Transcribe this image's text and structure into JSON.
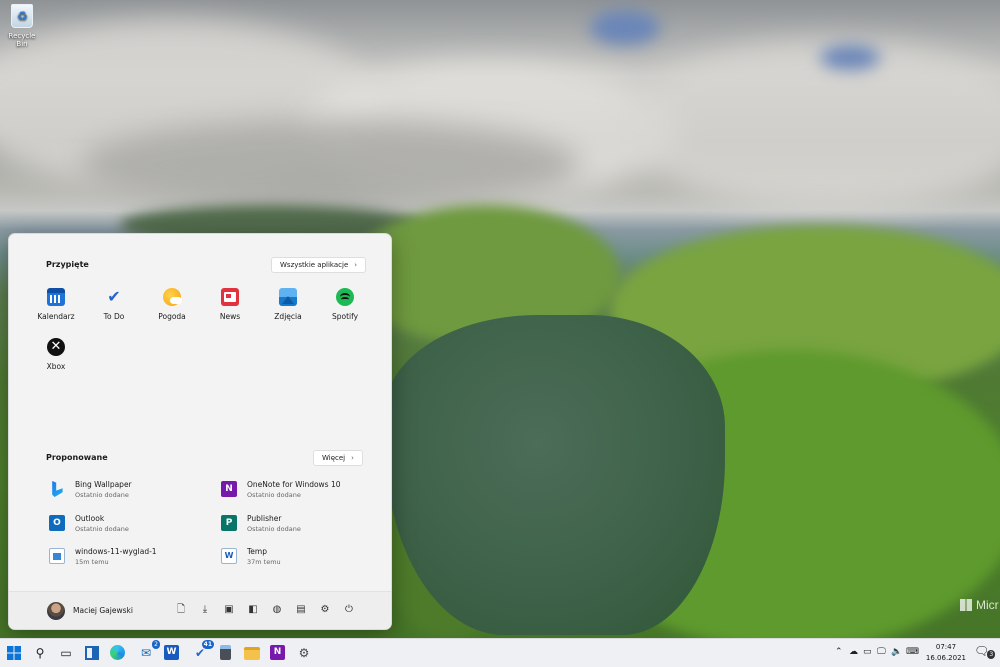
{
  "desktop": {
    "recycle_bin_label": "Recycle Bin",
    "watermark": "Micr"
  },
  "start_menu": {
    "pinned_title": "Przypięte",
    "all_apps_button": "Wszystkie aplikacje",
    "pinned_apps": [
      {
        "label": "Kalendarz",
        "icon": "calendar-icon",
        "color": "#1e73d8"
      },
      {
        "label": "To Do",
        "icon": "todo-check-icon",
        "color": "#2564cf"
      },
      {
        "label": "Pogoda",
        "icon": "weather-sun-icon",
        "color": "#f7b50f"
      },
      {
        "label": "News",
        "icon": "news-icon",
        "color": "#e2313f"
      },
      {
        "label": "Zdjęcia",
        "icon": "photos-icon",
        "color": "#1987d6"
      },
      {
        "label": "Spotify",
        "icon": "spotify-icon",
        "color": "#1db954"
      },
      {
        "label": "Xbox",
        "icon": "xbox-icon",
        "color": "#111111"
      }
    ],
    "recommended_title": "Proponowane",
    "more_button": "Więcej",
    "recommended": [
      {
        "title": "Bing Wallpaper",
        "subtitle": "Ostatnio dodane",
        "icon": "bing-icon",
        "color": "#1a73e8"
      },
      {
        "title": "OneNote for Windows 10",
        "subtitle": "Ostatnio dodane",
        "icon": "onenote-icon",
        "color": "#7719aa"
      },
      {
        "title": "Outlook",
        "subtitle": "Ostatnio dodane",
        "icon": "outlook-icon",
        "color": "#0f6cbd"
      },
      {
        "title": "Publisher",
        "subtitle": "Ostatnio dodane",
        "icon": "publisher-icon",
        "color": "#077568"
      },
      {
        "title": "windows-11-wyglad-1",
        "subtitle": "15m temu",
        "icon": "image-file-icon",
        "color": "#3a86d6"
      },
      {
        "title": "Temp",
        "subtitle": "37m temu",
        "icon": "word-doc-icon",
        "color": "#185abd"
      }
    ],
    "user_name": "Maciej Gajewski",
    "footer_icons": [
      "document-icon",
      "download-icon",
      "pictures-icon",
      "video-icon",
      "network-icon",
      "folder-user-icon",
      "settings-icon",
      "power-icon"
    ]
  },
  "taskbar": {
    "items": [
      "windows-start-icon",
      "search-icon",
      "task-view-icon",
      "widgets-icon",
      "edge-icon",
      "mail-icon",
      "word-icon",
      "todo-icon",
      "calculator-icon",
      "file-explorer-icon",
      "onenote-icon",
      "settings-icon"
    ],
    "badges": {
      "mail": "2",
      "todo": "41"
    },
    "time": "07:47",
    "date": "16.06.2021",
    "notification_count": "3"
  },
  "colors": {
    "accent": "#0067c0",
    "start_bg": "#f3f3f3",
    "taskbar_bg": "#eef0f3"
  }
}
